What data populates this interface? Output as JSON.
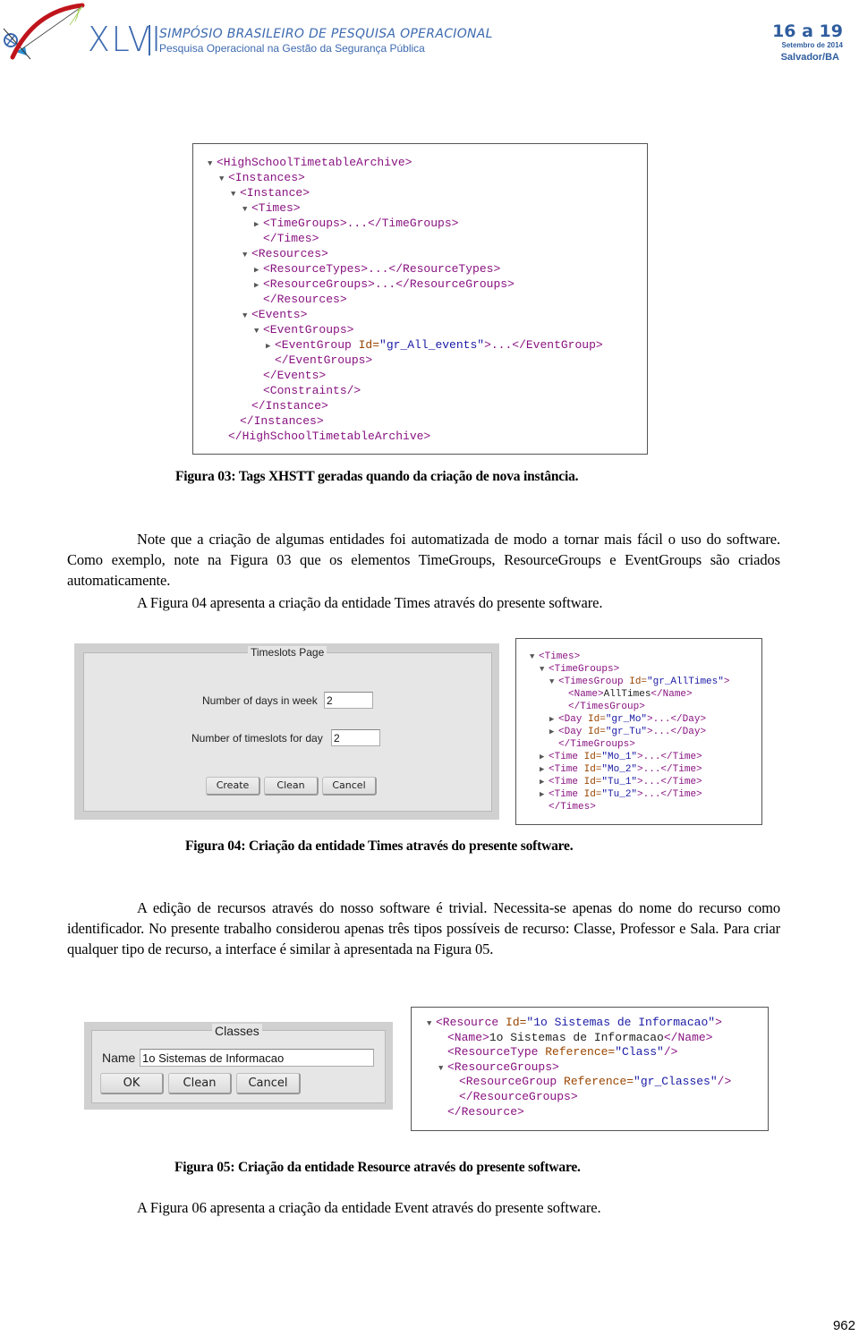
{
  "header": {
    "roman_numeral": "XLVI",
    "title": "SIMPÓSIO BRASILEIRO DE PESQUISA OPERACIONAL",
    "subtitle": "Pesquisa Operacional na Gestão da Segurança Pública",
    "dates": "16 a 19",
    "month_year": "Setembro de 2014",
    "city": "Salvador/BA",
    "colors": {
      "brand_blue": "#3d6ab0",
      "logo_red": "#c0141c"
    }
  },
  "figure03": {
    "xml_lines": [
      {
        "indent": 0,
        "toggle": "expanded",
        "parts": [
          [
            "tag",
            "<HighSchoolTimetableArchive>"
          ]
        ]
      },
      {
        "indent": 1,
        "toggle": "expanded",
        "parts": [
          [
            "tag",
            "<Instances>"
          ]
        ]
      },
      {
        "indent": 2,
        "toggle": "expanded",
        "parts": [
          [
            "tag",
            "<Instance>"
          ]
        ]
      },
      {
        "indent": 3,
        "toggle": "expanded",
        "parts": [
          [
            "tag",
            "<Times>"
          ]
        ]
      },
      {
        "indent": 4,
        "toggle": "collapsed",
        "parts": [
          [
            "tag",
            "<TimeGroups>...</TimeGroups>"
          ]
        ]
      },
      {
        "indent": 4,
        "toggle": "none",
        "parts": [
          [
            "tag",
            "</Times>"
          ]
        ]
      },
      {
        "indent": 3,
        "toggle": "expanded",
        "parts": [
          [
            "tag",
            "<Resources>"
          ]
        ]
      },
      {
        "indent": 4,
        "toggle": "collapsed",
        "parts": [
          [
            "tag",
            "<ResourceTypes>...</ResourceTypes>"
          ]
        ]
      },
      {
        "indent": 4,
        "toggle": "collapsed",
        "parts": [
          [
            "tag",
            "<ResourceGroups>...</ResourceGroups>"
          ]
        ]
      },
      {
        "indent": 4,
        "toggle": "none",
        "parts": [
          [
            "tag",
            "</Resources>"
          ]
        ]
      },
      {
        "indent": 3,
        "toggle": "expanded",
        "parts": [
          [
            "tag",
            "<Events>"
          ]
        ]
      },
      {
        "indent": 4,
        "toggle": "expanded",
        "parts": [
          [
            "tag",
            "<EventGroups>"
          ]
        ]
      },
      {
        "indent": 5,
        "toggle": "collapsed",
        "parts": [
          [
            "tag",
            "<EventGroup "
          ],
          [
            "attr",
            "Id="
          ],
          [
            "val",
            "\"gr_All_events\""
          ],
          [
            "tag",
            ">...</EventGroup>"
          ]
        ]
      },
      {
        "indent": 5,
        "toggle": "none",
        "parts": [
          [
            "tag",
            "</EventGroups>"
          ]
        ]
      },
      {
        "indent": 4,
        "toggle": "none",
        "parts": [
          [
            "tag",
            "</Events>"
          ]
        ]
      },
      {
        "indent": 4,
        "toggle": "none",
        "parts": [
          [
            "tag",
            "<Constraints/>"
          ]
        ]
      },
      {
        "indent": 3,
        "toggle": "none",
        "parts": [
          [
            "tag",
            "</Instance>"
          ]
        ]
      },
      {
        "indent": 2,
        "toggle": "none",
        "parts": [
          [
            "tag",
            "</Instances>"
          ]
        ]
      },
      {
        "indent": 1,
        "toggle": "none",
        "parts": [
          [
            "tag",
            "</HighSchoolTimetableArchive>"
          ]
        ]
      }
    ],
    "caption": "Figura 03: Tags XHSTT geradas quando da criação de nova instância."
  },
  "paragraph1": "Note que a criação de algumas entidades foi automatizada de modo a tornar mais fácil o uso do software. Como exemplo, note na Figura 03 que os elementos TimeGroups, ResourceGroups e EventGroups são criados automaticamente.",
  "paragraph2": "A Figura 04 apresenta a criação da entidade Times através do presente software.",
  "figure04": {
    "form": {
      "title": "Timeslots Page",
      "days_label": "Number of days in week",
      "days_value": "2",
      "slots_label": "Number of timeslots for day",
      "slots_value": "2",
      "buttons": {
        "create": "Create",
        "clean": "Clean",
        "cancel": "Cancel"
      }
    },
    "xml_lines": [
      {
        "indent": 0,
        "toggle": "expanded",
        "parts": [
          [
            "tag",
            "<Times>"
          ]
        ]
      },
      {
        "indent": 1,
        "toggle": "expanded",
        "parts": [
          [
            "tag",
            "<TimeGroups>"
          ]
        ]
      },
      {
        "indent": 2,
        "toggle": "expanded",
        "parts": [
          [
            "tag",
            "<TimesGroup "
          ],
          [
            "attr",
            "Id="
          ],
          [
            "val",
            "\"gr_AllTimes\""
          ],
          [
            "tag",
            ">"
          ]
        ]
      },
      {
        "indent": 3,
        "toggle": "none",
        "parts": [
          [
            "tag",
            "<Name>"
          ],
          [
            "txt",
            "AllTimes"
          ],
          [
            "tag",
            "</Name>"
          ]
        ]
      },
      {
        "indent": 3,
        "toggle": "none",
        "parts": [
          [
            "tag",
            "</TimesGroup>"
          ]
        ]
      },
      {
        "indent": 2,
        "toggle": "collapsed",
        "parts": [
          [
            "tag",
            "<Day "
          ],
          [
            "attr",
            "Id="
          ],
          [
            "val",
            "\"gr_Mo\""
          ],
          [
            "tag",
            ">...</Day>"
          ]
        ]
      },
      {
        "indent": 2,
        "toggle": "collapsed",
        "parts": [
          [
            "tag",
            "<Day "
          ],
          [
            "attr",
            "Id="
          ],
          [
            "val",
            "\"gr_Tu\""
          ],
          [
            "tag",
            ">...</Day>"
          ]
        ]
      },
      {
        "indent": 2,
        "toggle": "none",
        "parts": [
          [
            "tag",
            "</TimeGroups>"
          ]
        ]
      },
      {
        "indent": 1,
        "toggle": "collapsed",
        "parts": [
          [
            "tag",
            "<Time "
          ],
          [
            "attr",
            "Id="
          ],
          [
            "val",
            "\"Mo_1\""
          ],
          [
            "tag",
            ">...</Time>"
          ]
        ]
      },
      {
        "indent": 1,
        "toggle": "collapsed",
        "parts": [
          [
            "tag",
            "<Time "
          ],
          [
            "attr",
            "Id="
          ],
          [
            "val",
            "\"Mo_2\""
          ],
          [
            "tag",
            ">...</Time>"
          ]
        ]
      },
      {
        "indent": 1,
        "toggle": "collapsed",
        "parts": [
          [
            "tag",
            "<Time "
          ],
          [
            "attr",
            "Id="
          ],
          [
            "val",
            "\"Tu_1\""
          ],
          [
            "tag",
            ">...</Time>"
          ]
        ]
      },
      {
        "indent": 1,
        "toggle": "collapsed",
        "parts": [
          [
            "tag",
            "<Time "
          ],
          [
            "attr",
            "Id="
          ],
          [
            "val",
            "\"Tu_2\""
          ],
          [
            "tag",
            ">...</Time>"
          ]
        ]
      },
      {
        "indent": 1,
        "toggle": "none",
        "parts": [
          [
            "tag",
            "</Times>"
          ]
        ]
      }
    ],
    "caption": "Figura 04: Criação da entidade Times através do presente software."
  },
  "paragraph3": "A edição de recursos através do nosso software é trivial. Necessita-se apenas do nome do recurso como identificador. No presente trabalho considerou apenas três tipos possíveis de recurso: Classe, Professor e Sala. Para criar qualquer tipo de recurso, a interface é similar à apresentada na Figura 05.",
  "figure05": {
    "form": {
      "title": "Classes",
      "name_label": "Name",
      "name_value": "1o Sistemas de Informacao",
      "buttons": {
        "ok": "OK",
        "clean": "Clean",
        "cancel": "Cancel"
      }
    },
    "xml_lines": [
      {
        "indent": 0,
        "toggle": "expanded",
        "parts": [
          [
            "tag",
            "<Resource "
          ],
          [
            "attr",
            "Id="
          ],
          [
            "val",
            "\"1o Sistemas de Informacao\""
          ],
          [
            "tag",
            ">"
          ]
        ]
      },
      {
        "indent": 1,
        "toggle": "none",
        "parts": [
          [
            "tag",
            "<Name>"
          ],
          [
            "txt",
            "1o Sistemas de Informacao"
          ],
          [
            "tag",
            "</Name>"
          ]
        ]
      },
      {
        "indent": 1,
        "toggle": "none",
        "parts": [
          [
            "tag",
            "<ResourceType "
          ],
          [
            "attr",
            "Reference="
          ],
          [
            "val",
            "\"Class\""
          ],
          [
            "tag",
            "/>"
          ]
        ]
      },
      {
        "indent": 1,
        "toggle": "expanded",
        "parts": [
          [
            "tag",
            "<ResourceGroups>"
          ]
        ]
      },
      {
        "indent": 2,
        "toggle": "none",
        "parts": [
          [
            "tag",
            "<ResourceGroup "
          ],
          [
            "attr",
            "Reference="
          ],
          [
            "val",
            "\"gr_Classes\""
          ],
          [
            "tag",
            "/>"
          ]
        ]
      },
      {
        "indent": 2,
        "toggle": "none",
        "parts": [
          [
            "tag",
            "</ResourceGroups>"
          ]
        ]
      },
      {
        "indent": 1,
        "toggle": "none",
        "parts": [
          [
            "tag",
            "</Resource>"
          ]
        ]
      }
    ],
    "caption": "Figura 05: Criação da entidade Resource através do presente software."
  },
  "paragraph4": "A Figura 06 apresenta a criação da entidade Event através do presente software.",
  "page_number": "962"
}
